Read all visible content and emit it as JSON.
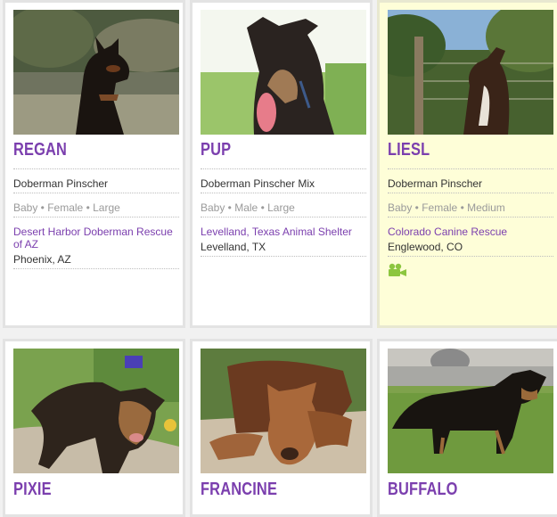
{
  "pets": [
    {
      "name": "REGAN",
      "breed": "Doberman Pinscher",
      "attributes": "Baby • Female • Large",
      "organization": "Desert Harbor Doberman Rescue of AZ",
      "location": "Phoenix, AZ",
      "photo": "doberman-puppy-photo"
    },
    {
      "name": "PUP",
      "breed": "Doberman Pinscher Mix",
      "attributes": "Baby • Male • Large",
      "organization": "Levelland, Texas Animal Shelter",
      "location": "Levelland, TX",
      "photo": "tongue-out-dog-photo"
    },
    {
      "name": "LIESL",
      "breed": "Doberman Pinscher",
      "attributes": "Baby • Female • Medium",
      "organization": "Colorado Canine Rescue",
      "location": "Englewood, CO",
      "photo": "dog-by-fence-photo",
      "has_video": true,
      "icon": "video-camera-icon",
      "highlight_color": "#fefed8"
    },
    {
      "name": "PIXIE",
      "photo": "puppy-on-grass-photo"
    },
    {
      "name": "FRANCINE",
      "photo": "red-puppy-photo"
    },
    {
      "name": "BUFFALO",
      "photo": "black-tan-puppy-photo"
    }
  ],
  "colors": {
    "name": "#7b3fae",
    "link": "#7b3fae",
    "text": "#333333",
    "muted": "#9a9a9a",
    "video_icon": "#8cc63f"
  }
}
